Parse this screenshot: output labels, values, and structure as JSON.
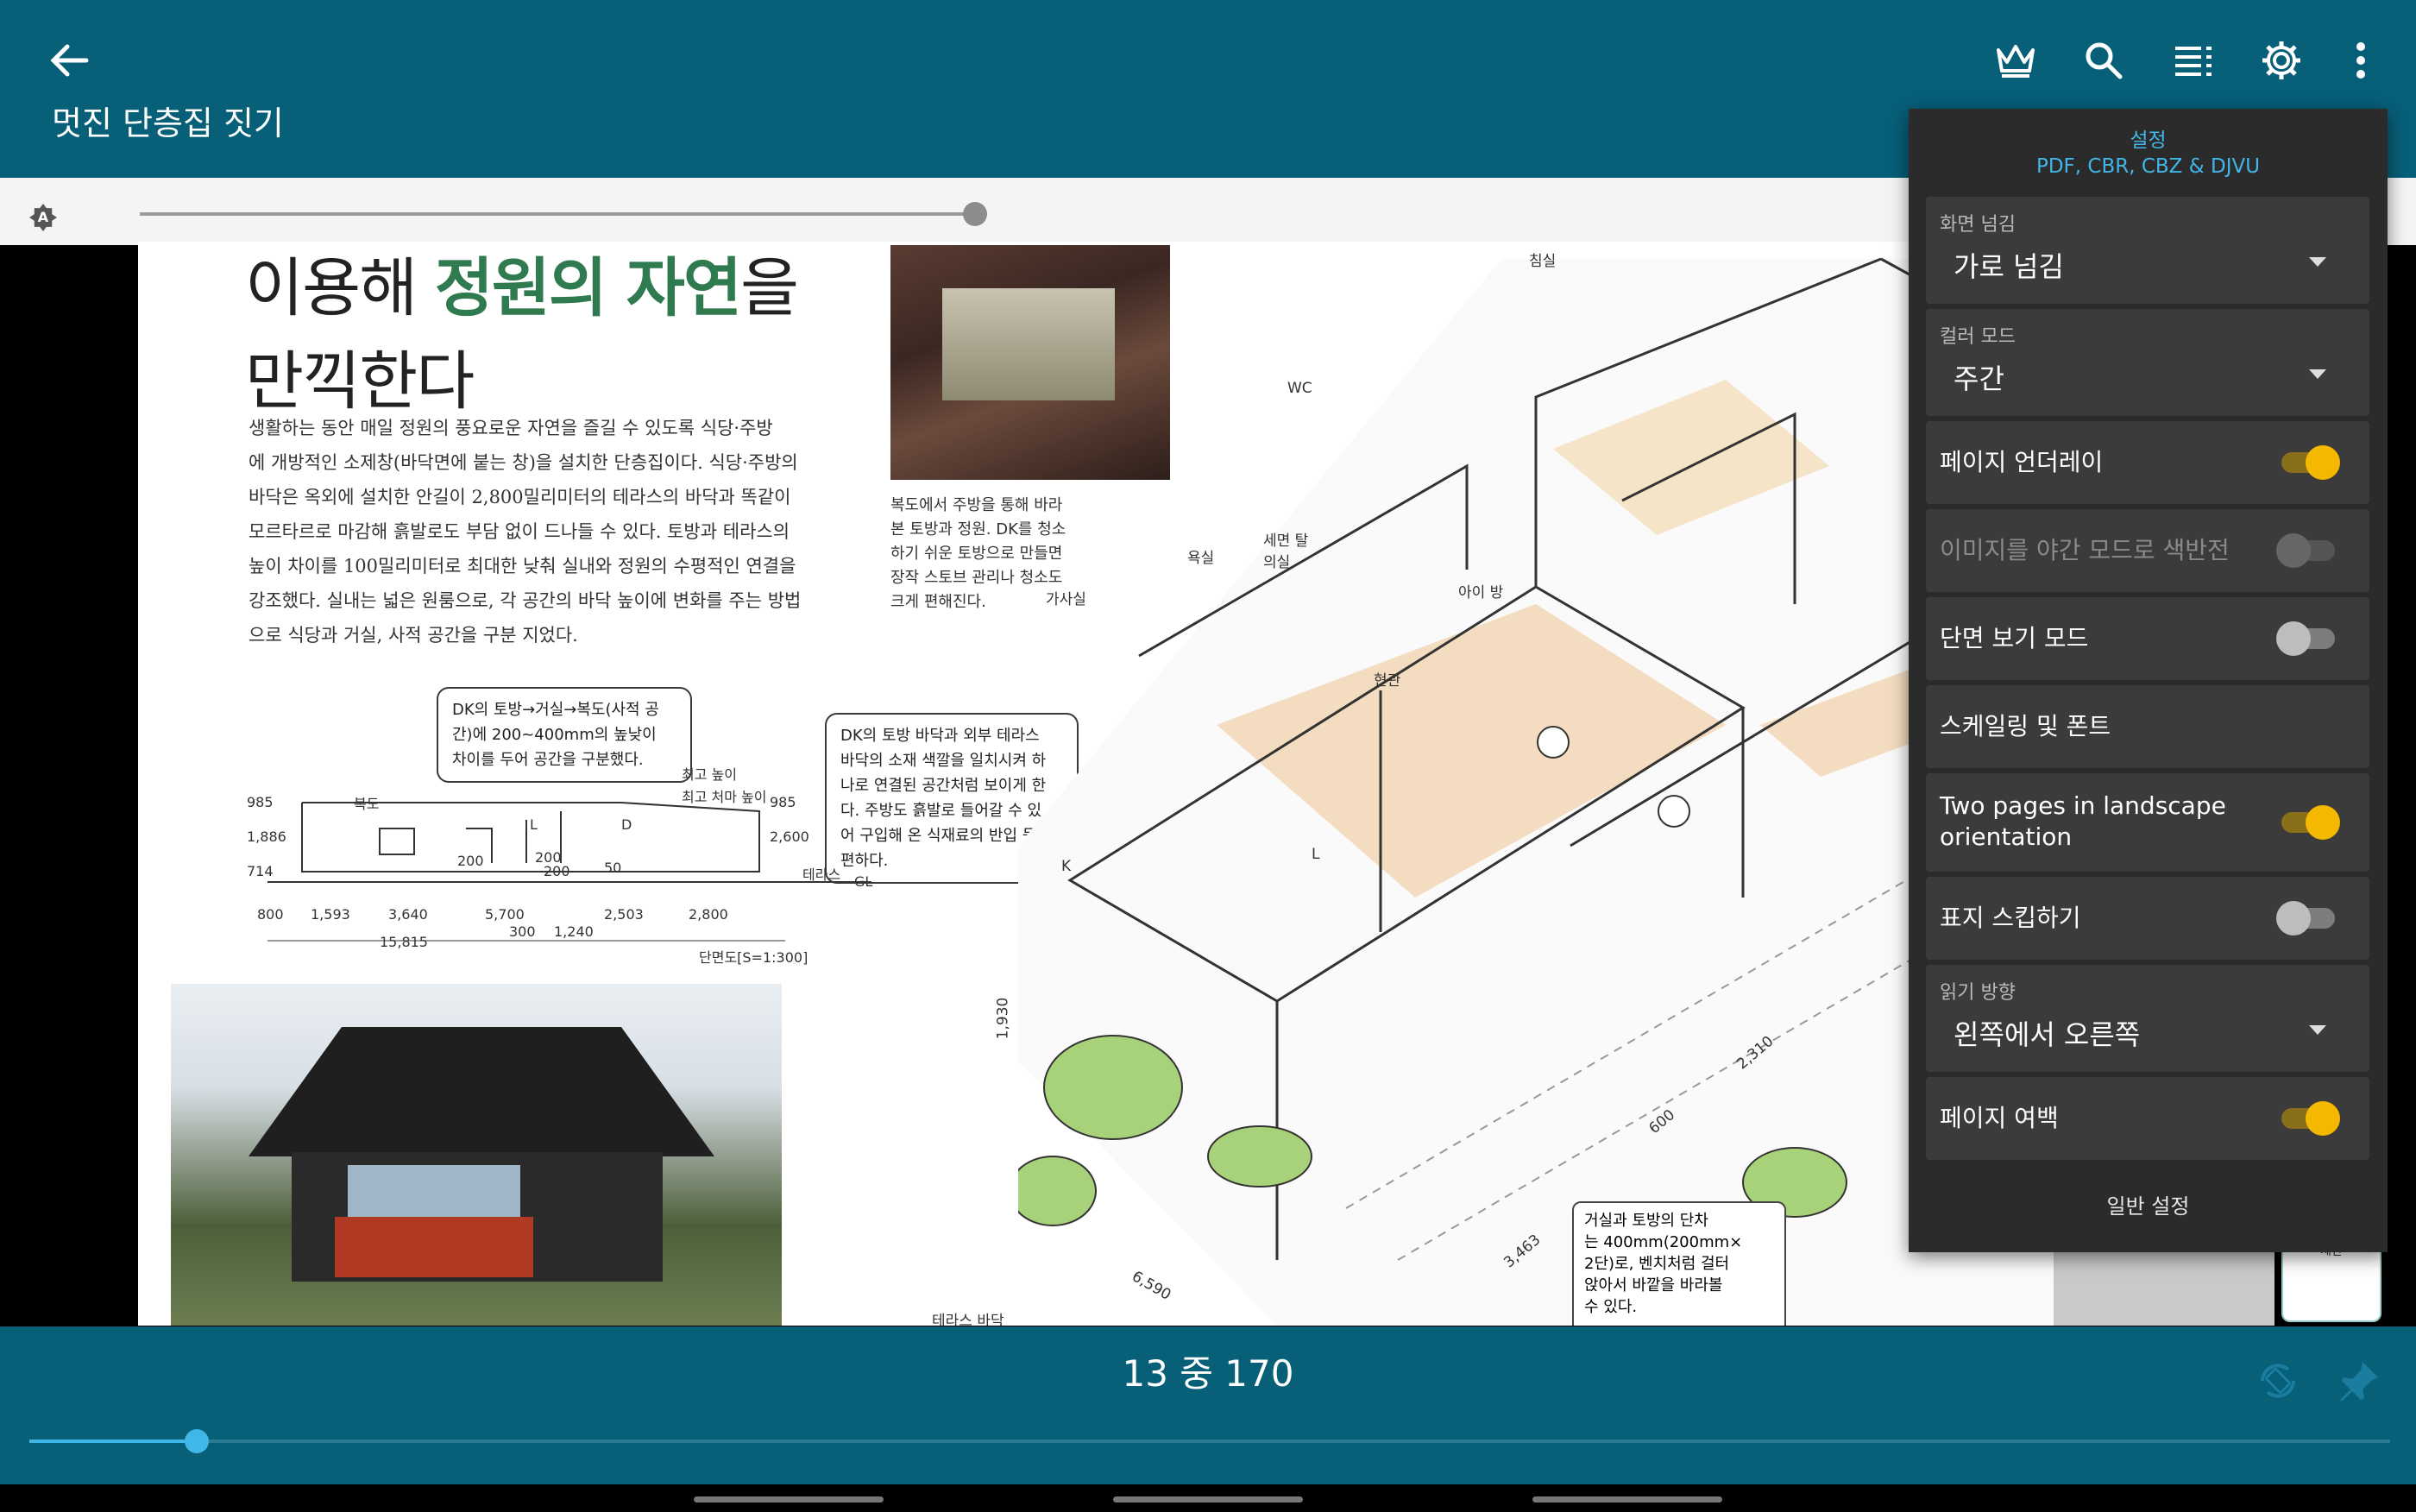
{
  "topbar": {
    "title": "멋진 단층집 짓기",
    "icons": [
      "back-arrow-icon",
      "crown-icon",
      "search-icon",
      "toc-list-icon",
      "gear-icon",
      "more-vert-icon"
    ]
  },
  "page_content": {
    "headline_pre": "이용해 ",
    "headline_green": "정원의 자연",
    "headline_post": "을",
    "headline_line2": "만끽한다",
    "body_lines": [
      "생활하는 동안 매일 정원의 풍요로운 자연을 즐길 수 있도록 식당·주방",
      "에 개방적인 소제창(바닥면에 붙는 창)을 설치한 단층집이다. 식당·주방의",
      "바닥은 옥외에 설치한 안길이 2,800밀리미터의 테라스의 바닥과 똑같이",
      "모르타르로 마감해 흙발로도 부담 없이 드나들 수 있다. 토방과 테라스의",
      "높이 차이를 100밀리미터로 최대한 낮춰 실내와 정원의 수평적인 연결을",
      "강조했다. 실내는 넓은 원룸으로, 각 공간의 바닥 높이에 변화를 주는 방법",
      "으로 식당과 거실, 사적 공간을 구분 지었다."
    ],
    "photo_caption_lines": [
      "복도에서 주방을 통해 바라",
      "본 토방과 정원. DK를 청소",
      "하기 쉬운 토방으로 만들면",
      "장작 스토브 관리나 청소도",
      "크게 편해진다."
    ],
    "note1_lines": [
      "DK의 토방→거실→복도(사적 공",
      "간)에 200~400mm의 높낮이",
      "차이를 두어 공간을 구분했다."
    ],
    "note2_lines": [
      "DK의 토방 바닥과 외부 테라스",
      "바닥의 소재 색깔을 일치시켜 하",
      "나로 연결된 공간처럼 보이게 한",
      "다. 주방도 흙발로 들어갈 수 있",
      "어 구입해 온 식재료의 반입 등이",
      "편하다."
    ],
    "section_labels": {
      "kitchen": "복도",
      "l": "L",
      "d": "D",
      "terrace": "테라스",
      "gl": "GL",
      "max_h": "최고 높이",
      "eave": "최고 처마 높이",
      "scale": "단면도[S=1:300]"
    },
    "section_dims": [
      "985",
      "1,886",
      "714",
      "2,600",
      "985",
      "200",
      "200",
      "200",
      "50",
      "800",
      "1,593",
      "3,640",
      "5,700",
      "2,503",
      "2,800",
      "300",
      "1,240",
      "15,815"
    ],
    "iso_labels": [
      "침실",
      "WC",
      "욕실",
      "세면 탈의실",
      "가사실",
      "아이 방",
      "현관",
      "K",
      "L",
      "테라스 바닥",
      "2,310",
      "600",
      "3,463",
      "6,590",
      "1,930"
    ],
    "caption_box_lines": [
      "거실과 토방의 단차",
      "는 400mm(200mm×",
      "2단)로, 벤치처럼 걸터",
      "앉아서 바깥을 바라볼",
      "수 있다."
    ],
    "side_fragment": "제한"
  },
  "settings_panel": {
    "header_line1": "설정",
    "header_line2": "PDF, CBR, CBZ & DJVU",
    "page_turn": {
      "label": "화면 넘김",
      "value": "가로 넘김"
    },
    "color_mode": {
      "label": "컬러 모드",
      "value": "주간"
    },
    "page_underlay": {
      "label": "페이지 언더레이",
      "on": true
    },
    "invert_images": {
      "label": "이미지를 야간 모드로 색반전",
      "on": false,
      "disabled": true
    },
    "section_view": {
      "label": "단면 보기 모드",
      "on": false
    },
    "scaling_fonts": {
      "label": "스케일링 및 폰트"
    },
    "two_pages": {
      "label_line1": "Two pages in landscape",
      "label_line2": "orientation",
      "on": true
    },
    "skip_cover": {
      "label": "표지 스킵하기",
      "on": false
    },
    "reading_dir": {
      "label": "읽기 방향",
      "value": "왼쪽에서 오른쪽"
    },
    "page_margins": {
      "label": "페이지 여백",
      "on": true
    },
    "footer": "일반 설정"
  },
  "bottombar": {
    "page_indicator": "13 중 170",
    "progress": 0.072,
    "icons": [
      "autorotate-icon",
      "pin-icon"
    ]
  },
  "colors": {
    "bar": "#075f78",
    "accent": "#3fb7e8",
    "toggle_on": "#f5b800",
    "panel": "#2b2b2b"
  }
}
